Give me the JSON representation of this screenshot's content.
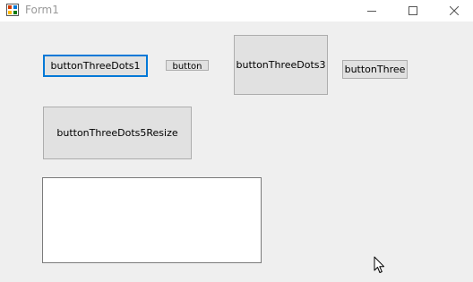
{
  "window": {
    "title": "Form1",
    "controls": [
      "minimize",
      "maximize",
      "close"
    ]
  },
  "buttons": {
    "b1": "buttonThreeDots1",
    "b2": "button",
    "b3": "buttonThreeDots3",
    "b4": "buttonThree",
    "b5": "buttonThreeDots5Resize"
  },
  "textbox": {
    "value": ""
  },
  "colors": {
    "focus_border": "#0078d7",
    "client_bg": "#efefef",
    "button_bg": "#e1e1e1"
  },
  "icons": {
    "app": "winforms-app-icon",
    "cursor": "mouse-pointer-icon"
  }
}
